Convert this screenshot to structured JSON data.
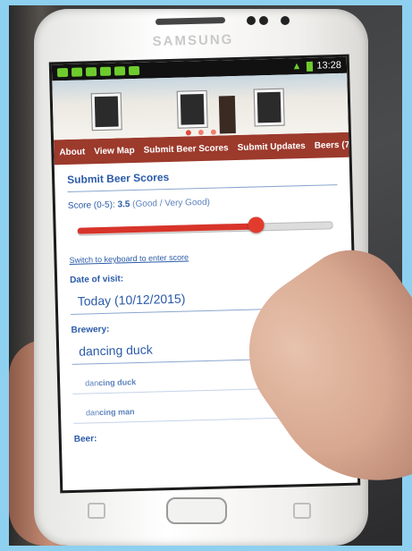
{
  "device": {
    "brand": "SAMSUNG"
  },
  "statusbar": {
    "time": "13:28"
  },
  "nav": {
    "tabs": [
      {
        "label": "About"
      },
      {
        "label": "View Map"
      },
      {
        "label": "Submit Beer Scores"
      },
      {
        "label": "Submit Updates"
      },
      {
        "label": "Beers (7"
      }
    ]
  },
  "form": {
    "section_title": "Submit Beer Scores",
    "score_label": "Score (0-5):",
    "score_value": "3.5",
    "score_desc": "(Good / Very Good)",
    "score_fraction": 0.7,
    "keyboard_link": "Switch to keyboard to enter score",
    "date_label": "Date of visit:",
    "date_value": "Today (10/12/2015)",
    "brewery_label": "Brewery:",
    "brewery_value": "dancing duck",
    "suggestions": [
      {
        "prefix": "dan",
        "rest": "cing duck"
      },
      {
        "prefix": "dan",
        "rest": "cing man"
      }
    ],
    "beer_label": "Beer:"
  },
  "colors": {
    "nav_bar": "#9c3a2c",
    "accent_text": "#2a5aa8",
    "slider_fill": "#d8342a"
  }
}
